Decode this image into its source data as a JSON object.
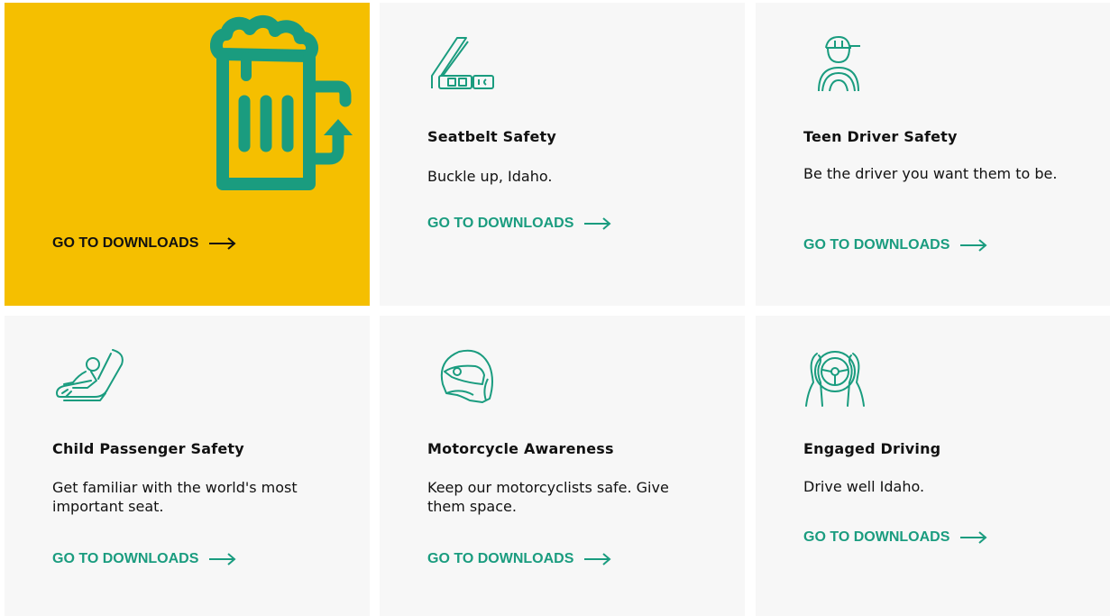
{
  "cards": [
    {
      "title": "",
      "description": "",
      "cta": "GO TO DOWNLOADS",
      "icon": "beer-mug-icon"
    },
    {
      "title": "Seatbelt Safety",
      "description": "Buckle up, Idaho.",
      "cta": "GO TO DOWNLOADS",
      "icon": "seatbelt-icon"
    },
    {
      "title": "Teen Driver Safety",
      "description": "Be the driver you want them to be.",
      "cta": "GO TO DOWNLOADS",
      "icon": "teen-driver-icon"
    },
    {
      "title": "Child Passenger Safety",
      "description": "Get familiar with the world's most important seat.",
      "cta": "GO TO DOWNLOADS",
      "icon": "car-seat-icon"
    },
    {
      "title": "Motorcycle Awareness",
      "description": "Keep our motorcyclists safe. Give them space.",
      "cta": "GO TO DOWNLOADS",
      "icon": "motorcycle-helmet-icon"
    },
    {
      "title": "Engaged Driving",
      "description": "Drive well Idaho.",
      "cta": "GO TO DOWNLOADS",
      "icon": "steering-wheel-icon"
    }
  ],
  "colors": {
    "accent": "#1a9c7f",
    "highlight": "#f5bf00",
    "card_bg": "#f7f7f7",
    "text": "#111111"
  }
}
